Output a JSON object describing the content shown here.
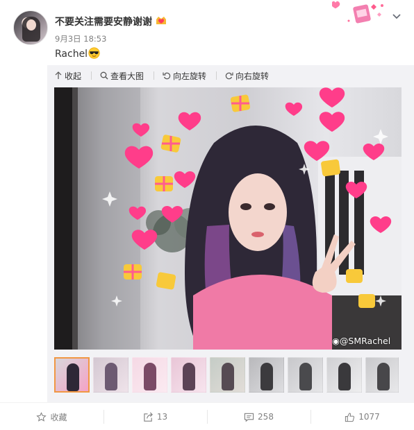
{
  "post": {
    "username": "不要关注需要安静谢谢",
    "time": "9月3日 18:53",
    "text": "Rachel"
  },
  "media_toolbar": {
    "collapse": "收起",
    "view_large": "查看大图",
    "rotate_left": "向左旋转",
    "rotate_right": "向右旋转"
  },
  "photo": {
    "watermark": "@SMRachel"
  },
  "thumbnails": {
    "count": 9,
    "active_index": 0
  },
  "actions": {
    "favorite": "收藏",
    "repost_count": "13",
    "comment_count": "258",
    "like_count": "1077"
  },
  "colors": {
    "accent_orange": "#f19743",
    "heart_pink": "#ff3d8a",
    "gift_yellow": "#f8c93a"
  },
  "icons": [
    "chevron-down-icon",
    "vip-badge-icon",
    "sunglasses-emoji",
    "arrow-up-icon",
    "magnifier-icon",
    "rotate-left-icon",
    "rotate-right-icon",
    "weibo-logo-icon",
    "star-icon",
    "share-icon",
    "comment-icon",
    "thumbs-up-icon"
  ]
}
